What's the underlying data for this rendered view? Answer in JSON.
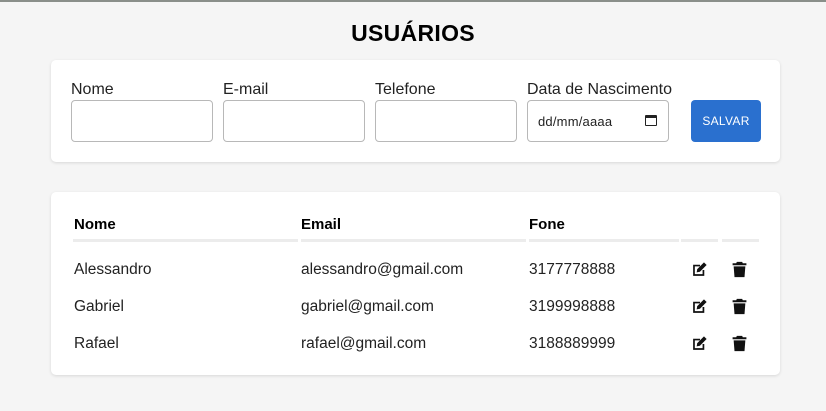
{
  "page": {
    "title": "USUÁRIOS"
  },
  "form": {
    "name_label": "Nome",
    "email_label": "E-mail",
    "phone_label": "Telefone",
    "birthdate_label": "Data de Nascimento",
    "birthdate_placeholder": "dd/mm/aaaa",
    "save_label": "SALVAR"
  },
  "table": {
    "headers": {
      "name": "Nome",
      "email": "Email",
      "phone": "Fone"
    },
    "rows": [
      {
        "name": "Alessandro",
        "email": "alessandro@gmail.com",
        "phone": "3177778888"
      },
      {
        "name": "Gabriel",
        "email": "gabriel@gmail.com",
        "phone": "3199998888"
      },
      {
        "name": "Rafael",
        "email": "rafael@gmail.com",
        "phone": "3188889999"
      }
    ]
  },
  "icons": {
    "edit": "edit-icon",
    "delete": "trash-icon"
  },
  "colors": {
    "accent": "#2a70cf",
    "background": "#f5f5f5",
    "card": "#ffffff"
  }
}
